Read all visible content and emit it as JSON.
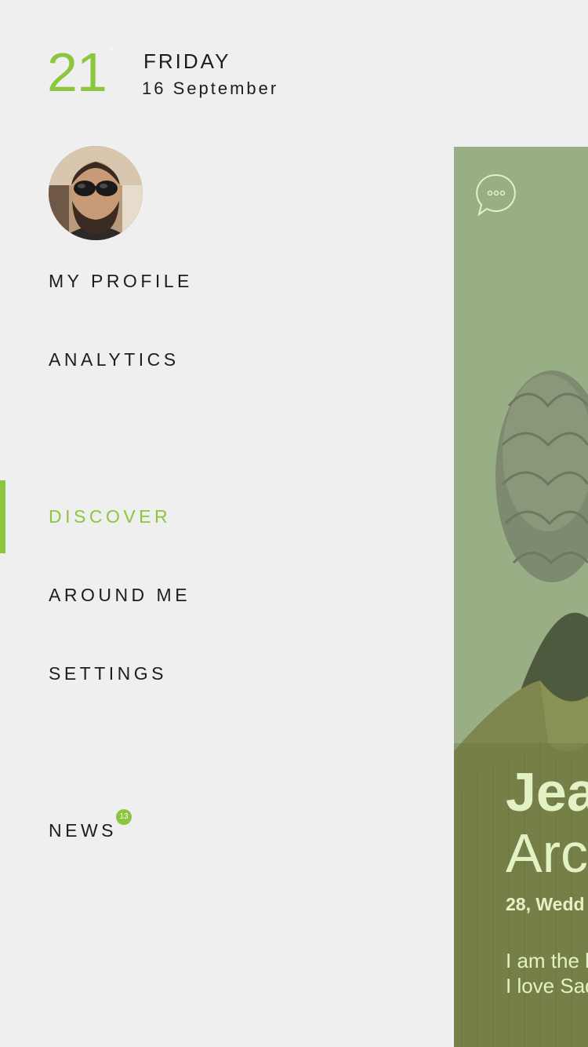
{
  "header": {
    "day_number": "21",
    "day_suffix": "°",
    "weekday": "FRIDAY",
    "full_date": "16 September"
  },
  "profile": {
    "avatar_icon": "avatar-photo"
  },
  "menu": {
    "items": [
      {
        "label": "MY PROFILE"
      },
      {
        "label": "ANALYTICS"
      },
      {
        "label": "DISCOVER",
        "active": true
      },
      {
        "label": "AROUND ME"
      },
      {
        "label": "SETTINGS"
      },
      {
        "label": "NEWS",
        "badge": "13"
      }
    ]
  },
  "card": {
    "chat_icon": "chat-bubble-icon",
    "first_name": "Jea",
    "last_name": "Arc",
    "subtitle": "28, Wedd",
    "bio_line_1": "I am the b",
    "bio_line_2": "I love Sad"
  },
  "colors": {
    "accent": "#8cc63f",
    "background": "#efefef",
    "text": "#1d1d1d",
    "card_overlay": "#9aae86",
    "card_text": "#e3f2c5"
  }
}
